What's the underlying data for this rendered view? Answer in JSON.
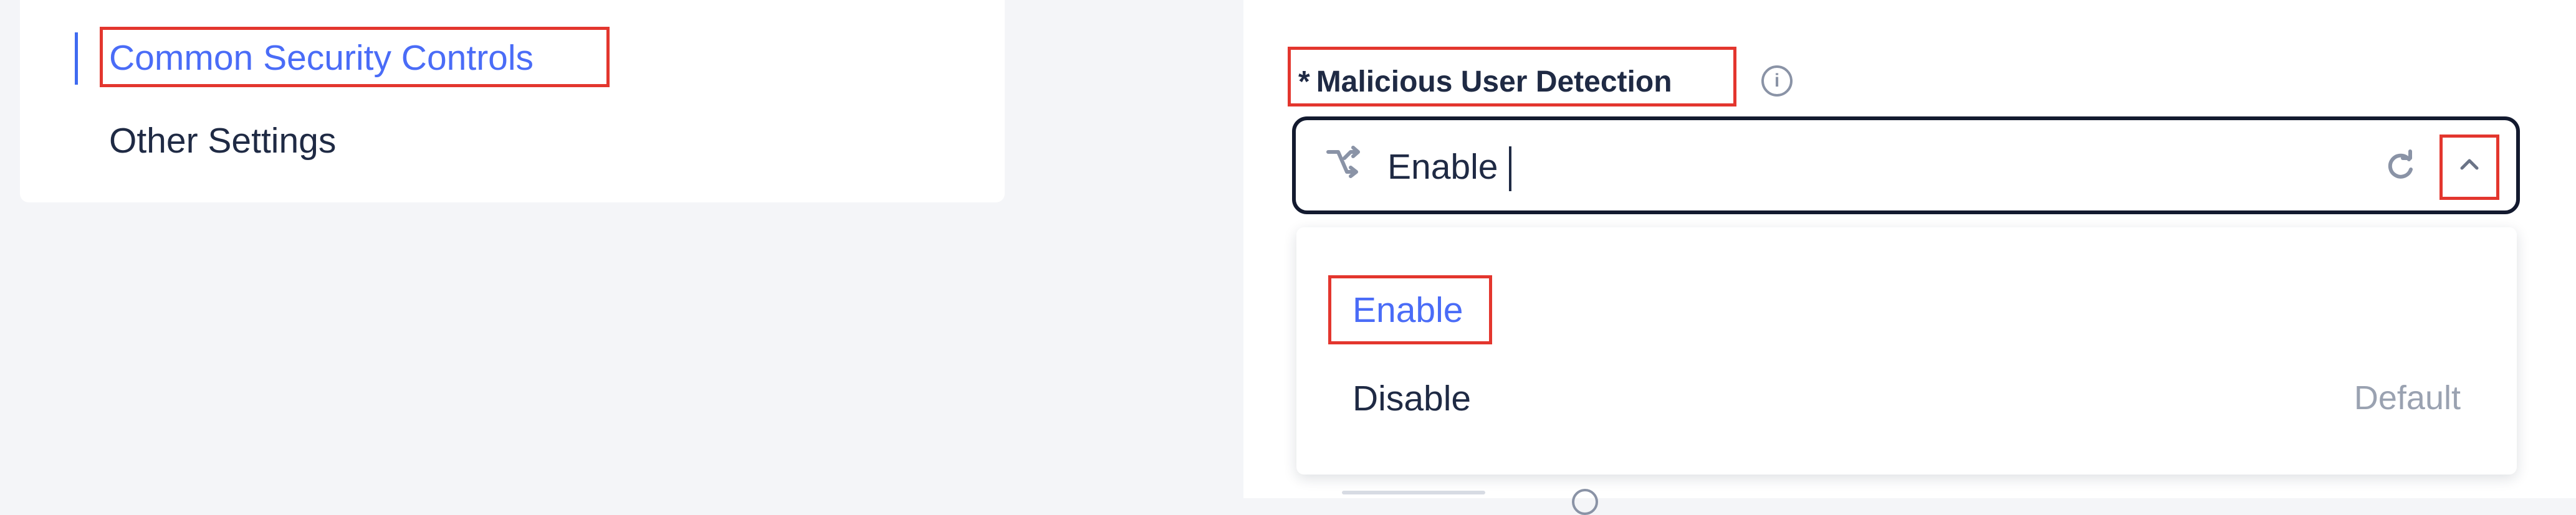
{
  "sidebar": {
    "items": [
      {
        "label": "Common Security Controls",
        "active": true
      },
      {
        "label": "Other Settings",
        "active": false
      }
    ]
  },
  "field": {
    "required_mark": "*",
    "label": "Malicious User Detection",
    "info_icon": "info-icon",
    "selected_value": "Enable"
  },
  "dropdown": {
    "options": [
      {
        "label": "Enable",
        "tag": ""
      },
      {
        "label": "Disable",
        "tag": "Default"
      }
    ]
  },
  "colors": {
    "accent": "#4a6cf7",
    "highlight": "#e3362e",
    "text": "#1f2a44",
    "muted": "#9aa2b1"
  }
}
